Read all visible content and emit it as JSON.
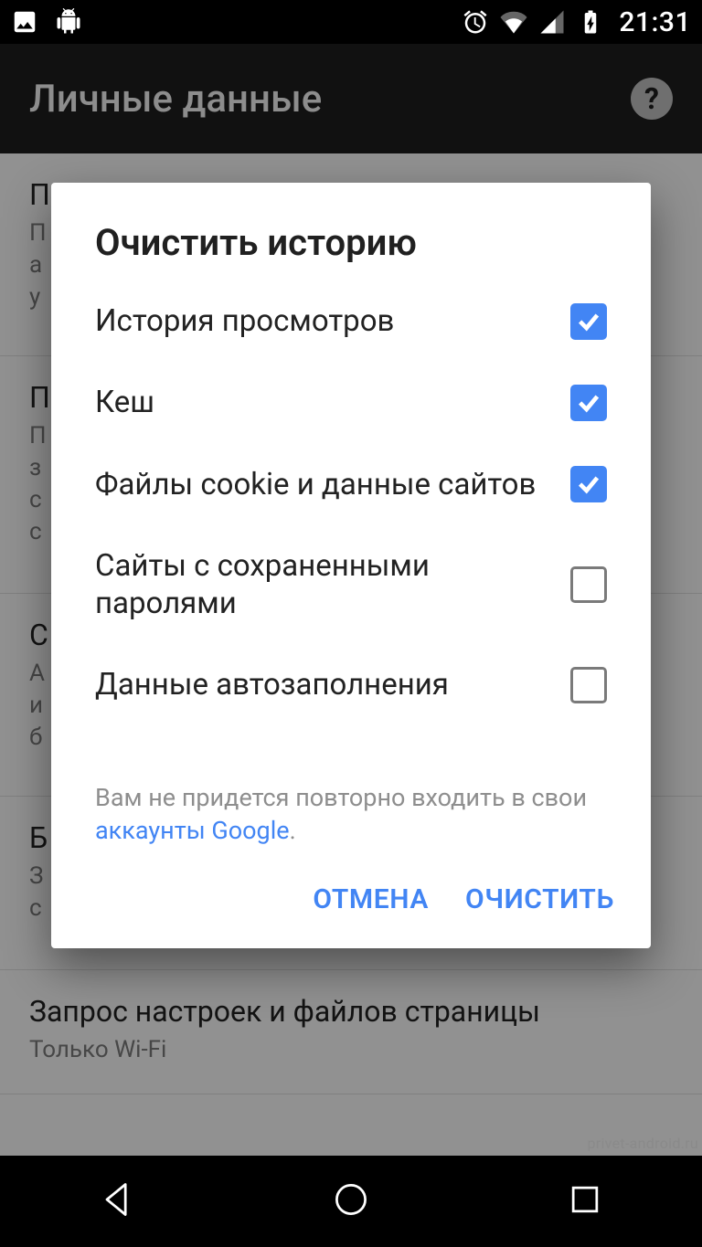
{
  "status": {
    "time": "21:31"
  },
  "appbar": {
    "title": "Личные данные"
  },
  "bg": {
    "items": [
      {
        "title": "П",
        "sub": "П\nа\nу"
      },
      {
        "title": "П",
        "sub": "П\nз\nс\nс"
      },
      {
        "title": "С",
        "sub": "А\nи\nб"
      },
      {
        "title": "Б",
        "sub": "З\nс"
      },
      {
        "title": "Запрос настроек и файлов страницы",
        "sub": "Только Wi-Fi"
      }
    ]
  },
  "dialog": {
    "title": "Очистить историю",
    "options": [
      {
        "label": "История просмотров",
        "checked": true
      },
      {
        "label": "Кеш",
        "checked": true
      },
      {
        "label": "Файлы cookie и данные сайтов",
        "checked": true
      },
      {
        "label": "Сайты с сохраненными паролями",
        "checked": false
      },
      {
        "label": "Данные автозаполнения",
        "checked": false
      }
    ],
    "footer_pre": "Вам не придется повторно входить в свои ",
    "footer_link": "аккаунты Google",
    "footer_post": ".",
    "cancel": "ОТМЕНА",
    "confirm": "ОЧИСТИТЬ"
  },
  "watermark": "privet-android.ru"
}
